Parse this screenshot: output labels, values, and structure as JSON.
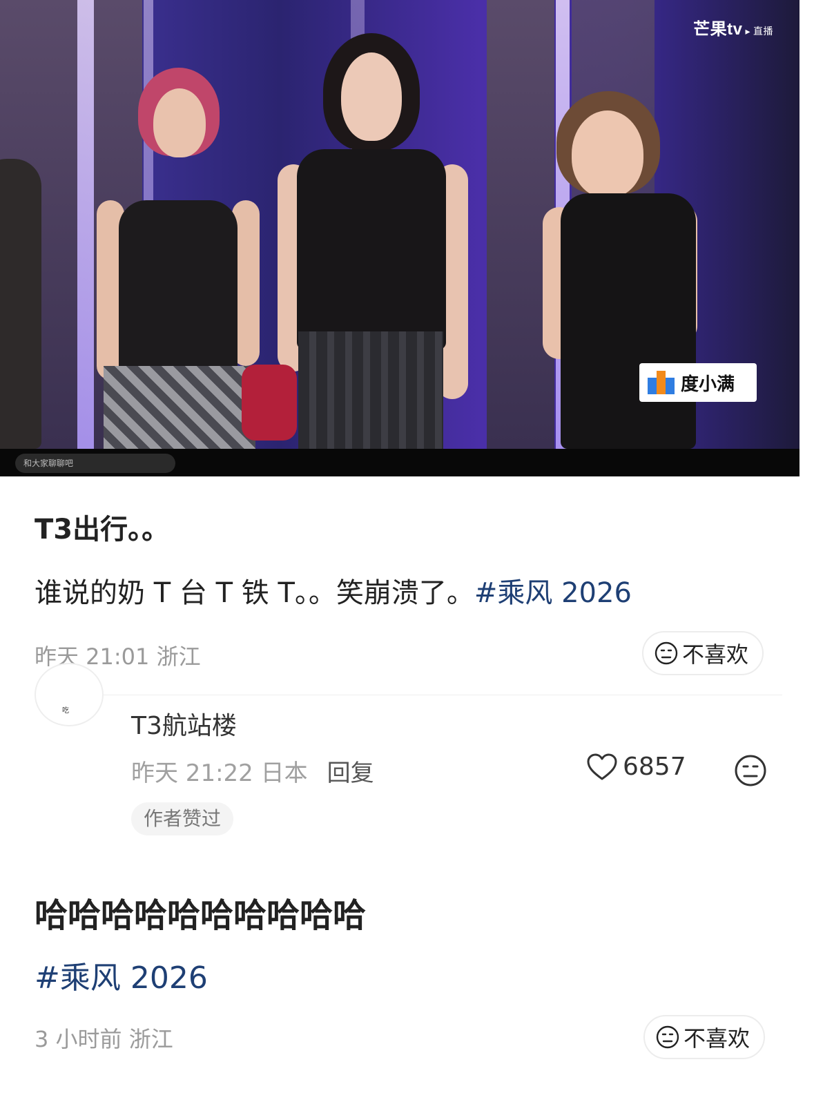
{
  "video": {
    "logo": "芒果tv",
    "live_label": "直播",
    "sponsor": "度小满",
    "chat_hint": "和大家聊聊吧"
  },
  "post1": {
    "title": "T3出行。。",
    "body": "谁说的奶 T 台 T 铁 T。。笑崩溃了。",
    "hashtag": "#乘风 2026",
    "time": "昨天 21:01",
    "location": "浙江",
    "dislike_label": "不喜欢"
  },
  "comment": {
    "avatar_text": "吃",
    "name": "T3航站楼",
    "time": "昨天 21:22",
    "location": "日本",
    "reply_label": "回复",
    "likes": "6857",
    "author_badge": "作者赞过"
  },
  "post2": {
    "title": "哈哈哈哈哈哈哈哈哈哈",
    "hashtag": "#乘风 2026",
    "time": "3 小时前",
    "location": "浙江",
    "dislike_label": "不喜欢"
  },
  "icons": [
    "heart-icon",
    "meh-face-icon",
    "play-triangle-icon"
  ],
  "colors": {
    "hashtag": "#1e3f74",
    "meta_text": "#9a9a9a"
  }
}
